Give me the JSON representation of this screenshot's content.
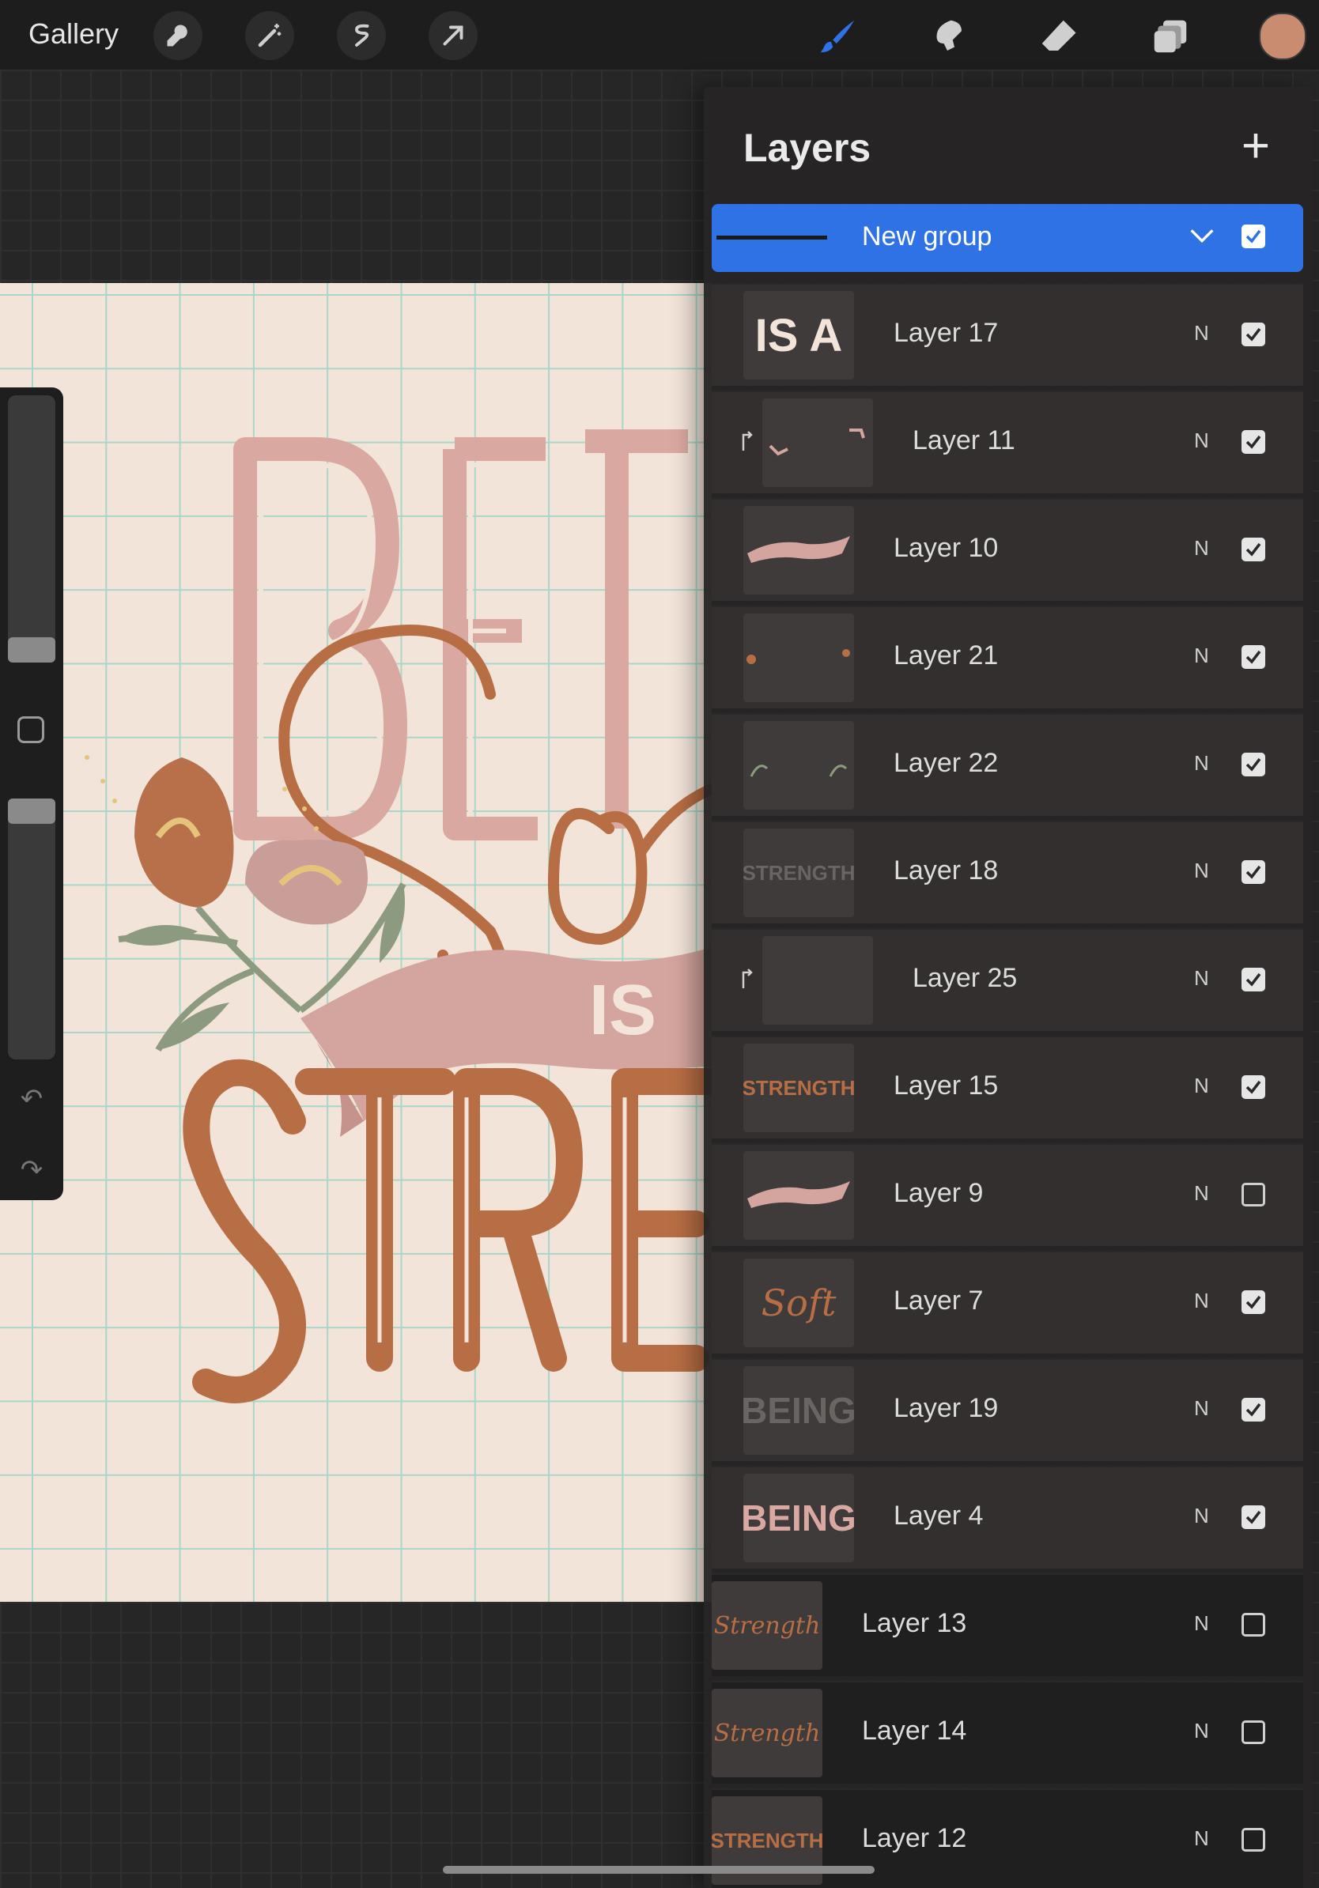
{
  "topbar": {
    "gallery_label": "Gallery",
    "tools_left": [
      "wrench-icon",
      "magic-wand-icon",
      "selection-icon",
      "transform-arrow-icon"
    ],
    "tools_right": [
      "brush-icon",
      "smudge-icon",
      "eraser-icon",
      "layers-icon"
    ],
    "active_tool": "brush-icon",
    "accent_color": "#2f72e6",
    "current_color": "#c98c71"
  },
  "canvas": {
    "artwork_text": [
      "BEI",
      "IS",
      "STRE"
    ]
  },
  "sidebar": {
    "size_level": 0.1,
    "opacity_level": 0.85
  },
  "layers_panel": {
    "title": "Layers",
    "add_label": "+",
    "group": {
      "name": "New group",
      "visible": true
    },
    "layers": [
      {
        "name": "Layer 17",
        "blend": "N",
        "visible": true,
        "clipped": false,
        "in_group": true,
        "thumb": "IS A"
      },
      {
        "name": "Layer 11",
        "blend": "N",
        "visible": true,
        "clipped": true,
        "in_group": true,
        "thumb": ""
      },
      {
        "name": "Layer 10",
        "blend": "N",
        "visible": true,
        "clipped": false,
        "in_group": true,
        "thumb": ""
      },
      {
        "name": "Layer 21",
        "blend": "N",
        "visible": true,
        "clipped": false,
        "in_group": true,
        "thumb": ""
      },
      {
        "name": "Layer 22",
        "blend": "N",
        "visible": true,
        "clipped": false,
        "in_group": true,
        "thumb": ""
      },
      {
        "name": "Layer 18",
        "blend": "N",
        "visible": true,
        "clipped": false,
        "in_group": true,
        "thumb": "STRENGTH"
      },
      {
        "name": "Layer 25",
        "blend": "N",
        "visible": true,
        "clipped": true,
        "in_group": true,
        "thumb": ""
      },
      {
        "name": "Layer 15",
        "blend": "N",
        "visible": true,
        "clipped": false,
        "in_group": true,
        "thumb": "STRENGTH"
      },
      {
        "name": "Layer 9",
        "blend": "N",
        "visible": false,
        "clipped": false,
        "in_group": true,
        "thumb": ""
      },
      {
        "name": "Layer 7",
        "blend": "N",
        "visible": true,
        "clipped": false,
        "in_group": true,
        "thumb": "Soft"
      },
      {
        "name": "Layer 19",
        "blend": "N",
        "visible": true,
        "clipped": false,
        "in_group": true,
        "thumb": "BEING"
      },
      {
        "name": "Layer 4",
        "blend": "N",
        "visible": true,
        "clipped": false,
        "in_group": true,
        "thumb": "BEING"
      },
      {
        "name": "Layer 13",
        "blend": "N",
        "visible": false,
        "clipped": false,
        "in_group": false,
        "thumb": "Strength"
      },
      {
        "name": "Layer 14",
        "blend": "N",
        "visible": false,
        "clipped": false,
        "in_group": false,
        "thumb": "Strength"
      },
      {
        "name": "Layer 12",
        "blend": "N",
        "visible": false,
        "clipped": false,
        "in_group": false,
        "thumb": "STRENGTH"
      }
    ]
  }
}
